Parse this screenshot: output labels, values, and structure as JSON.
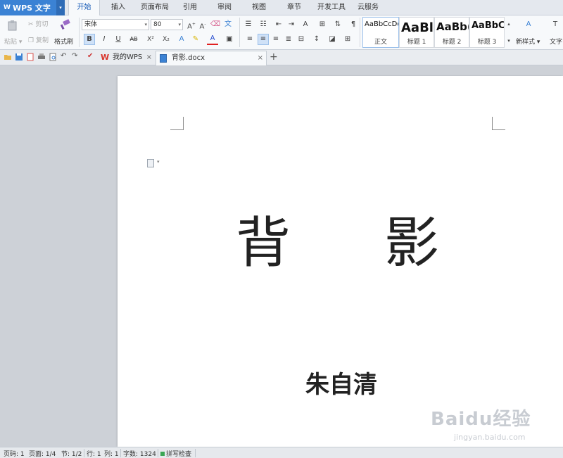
{
  "app": {
    "name": "WPS 文字"
  },
  "menu_tabs": [
    "开始",
    "插入",
    "页面布局",
    "引用",
    "审阅",
    "视图",
    "章节",
    "开发工具",
    "云服务"
  ],
  "clipboard": {
    "paste": "粘贴",
    "cut": "剪切",
    "copy": "复制",
    "format_painter": "格式刷"
  },
  "font": {
    "name": "宋体",
    "size": "80"
  },
  "styles": [
    {
      "sample": "AaBbCcDd",
      "label": "正文"
    },
    {
      "sample": "AaBl",
      "label": "标题 1"
    },
    {
      "sample": "AaBb(",
      "label": "标题 2"
    },
    {
      "sample": "AaBbC",
      "label": "标题 3"
    }
  ],
  "new_style": "新样式",
  "text_tools": "文字",
  "format_buttons": {
    "bold": "B",
    "italic": "I",
    "underline": "U",
    "strike": "AB",
    "superscript": "X²",
    "subscript": "X₂"
  },
  "doc_tabs": [
    {
      "label": "我的WPS"
    },
    {
      "label": "背影.docx"
    }
  ],
  "document": {
    "title_left": "背",
    "title_right": "影",
    "author": "朱自清"
  },
  "status": {
    "page_code": "页码: 1",
    "page": "页面: 1/4",
    "section": "节: 1/2",
    "row": "行: 1",
    "col": "列: 1",
    "words": "字数: 1324",
    "spell": "拼写检查"
  },
  "watermark": {
    "text": "Baidu经验",
    "sub": "jingyan.baidu.com"
  },
  "colors": {
    "accent": "#3b82d4",
    "active_tab_text": "#1d5fb8",
    "page": "#ffffff",
    "workspace": "#cdd1d7"
  }
}
